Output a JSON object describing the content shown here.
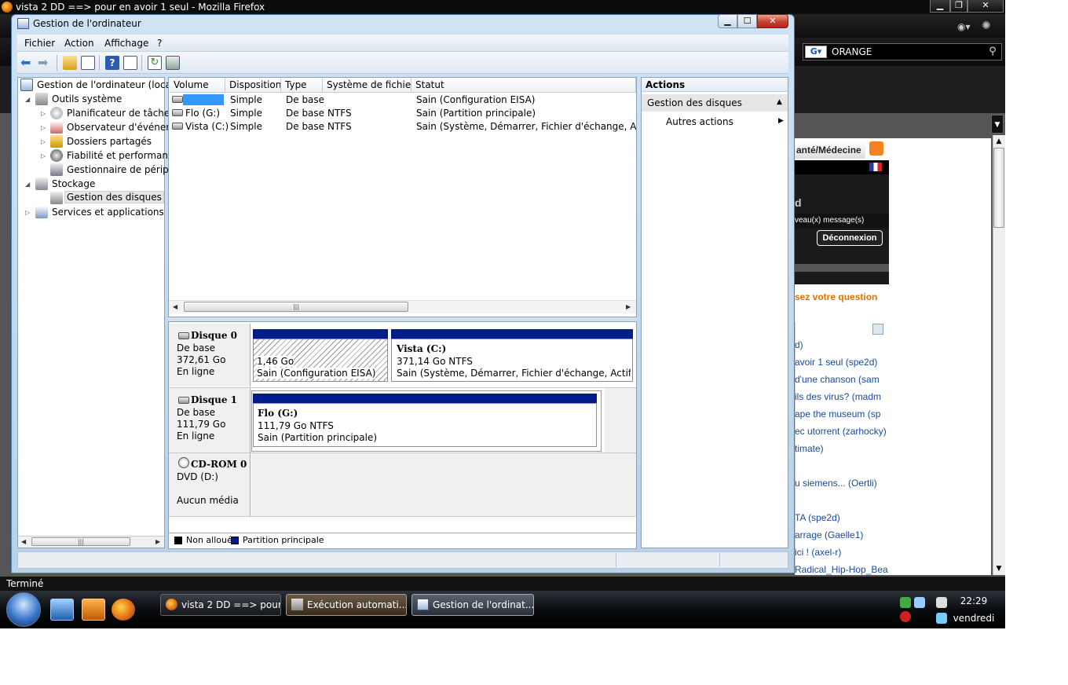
{
  "browser": {
    "title": "vista 2 DD ==> pour en avoir 1 seul - Mozilla Firefox",
    "search_value": "ORANGE",
    "search_engine_label": "G",
    "status_text": "Terminé",
    "web": {
      "tab_label": "anté/Médecine",
      "letter": "d",
      "messages": "veau(x) message(s)",
      "logout_label": "Déconnexion",
      "question_link": "sez votre question",
      "list": [
        {
          "text": "d)"
        },
        {
          "text": "avoir 1 seul (spe2d)"
        },
        {
          "text": "d'une chanson (sam"
        },
        {
          "text": "ils des virus? (madm"
        },
        {
          "text": "ape the museum (sp"
        },
        {
          "text": "ec utorrent (zarhocky)"
        },
        {
          "text": "timate)"
        },
        {
          "text": "u siemens... (Oertli)"
        },
        {
          "text": "TA (spe2d)"
        },
        {
          "text": "arrage (Gaelle1)"
        },
        {
          "text": "ici ! (axel-r)"
        },
        {
          "text": "Radical_Hip-Hop_Bea"
        }
      ]
    }
  },
  "window": {
    "title": "Gestion de l'ordinateur",
    "menu": [
      "Fichier",
      "Action",
      "Affichage",
      "?"
    ]
  },
  "tree": {
    "root": "Gestion de l'ordinateur (local)",
    "items": [
      "Outils système",
      "Planificateur de tâches",
      "Observateur d'événeme",
      "Dossiers partagés",
      "Fiabilité et performance",
      "Gestionnaire de périphé",
      "Stockage",
      "Gestion des disques",
      "Services et applications"
    ]
  },
  "volumes": {
    "columns": [
      "Volume",
      "Disposition",
      "Type",
      "Système de fichiers",
      "Statut"
    ],
    "rows": [
      {
        "volume": "",
        "disposition": "Simple",
        "type": "De base",
        "fs": "",
        "status": "Sain (Configuration EISA)"
      },
      {
        "volume": "Flo (G:)",
        "disposition": "Simple",
        "type": "De base",
        "fs": "NTFS",
        "status": "Sain (Partition principale)"
      },
      {
        "volume": "Vista (C:)",
        "disposition": "Simple",
        "type": "De base",
        "fs": "NTFS",
        "status": "Sain (Système, Démarrer, Fichier d'échange, Actif, Vid"
      }
    ]
  },
  "disks": [
    {
      "name": "Disque 0",
      "kind": "De base",
      "size": "372,61 Go",
      "state": "En ligne",
      "partitions": [
        {
          "title": "",
          "size": "1,46 Go",
          "status": "Sain (Configuration EISA)"
        },
        {
          "title": "Vista  (C:)",
          "size": "371,14 Go NTFS",
          "status": "Sain (Système, Démarrer, Fichier d'échange, Actif, Vidag"
        }
      ]
    },
    {
      "name": "Disque 1",
      "kind": "De base",
      "size": "111,79 Go",
      "state": "En ligne",
      "partitions": [
        {
          "title": "Flo  (G:)",
          "size": "111,79 Go NTFS",
          "status": "Sain (Partition principale)"
        }
      ]
    },
    {
      "name": "CD-ROM 0",
      "kind": "DVD (D:)",
      "size": "",
      "state": "Aucun média",
      "partitions": []
    }
  ],
  "legend": [
    {
      "label": "Non alloué",
      "color": "#000000"
    },
    {
      "label": "Partition principale",
      "color": "#001d8c"
    }
  ],
  "actions": {
    "header": "Actions",
    "section": "Gestion des disques",
    "more": "Autres actions"
  },
  "taskbar": {
    "buttons": [
      "vista 2 DD ==> pour...",
      "Exécution automati...",
      "Gestion de l'ordinat..."
    ],
    "time": "22:29",
    "day": "vendredi"
  },
  "colors": {
    "partition_header": "#001d8c",
    "selection": "#3399ff",
    "firefox_accent": "#e06a10"
  },
  "icons": [
    "firefox-icon",
    "computer-management-icon",
    "back-arrow-icon",
    "forward-arrow-icon",
    "up-folder-icon",
    "console-tree-icon",
    "help-icon",
    "properties-icon",
    "refresh-icon",
    "export-icon",
    "disk-icon",
    "cdrom-icon",
    "start-orb-icon",
    "rss-icon",
    "flag-icon"
  ]
}
